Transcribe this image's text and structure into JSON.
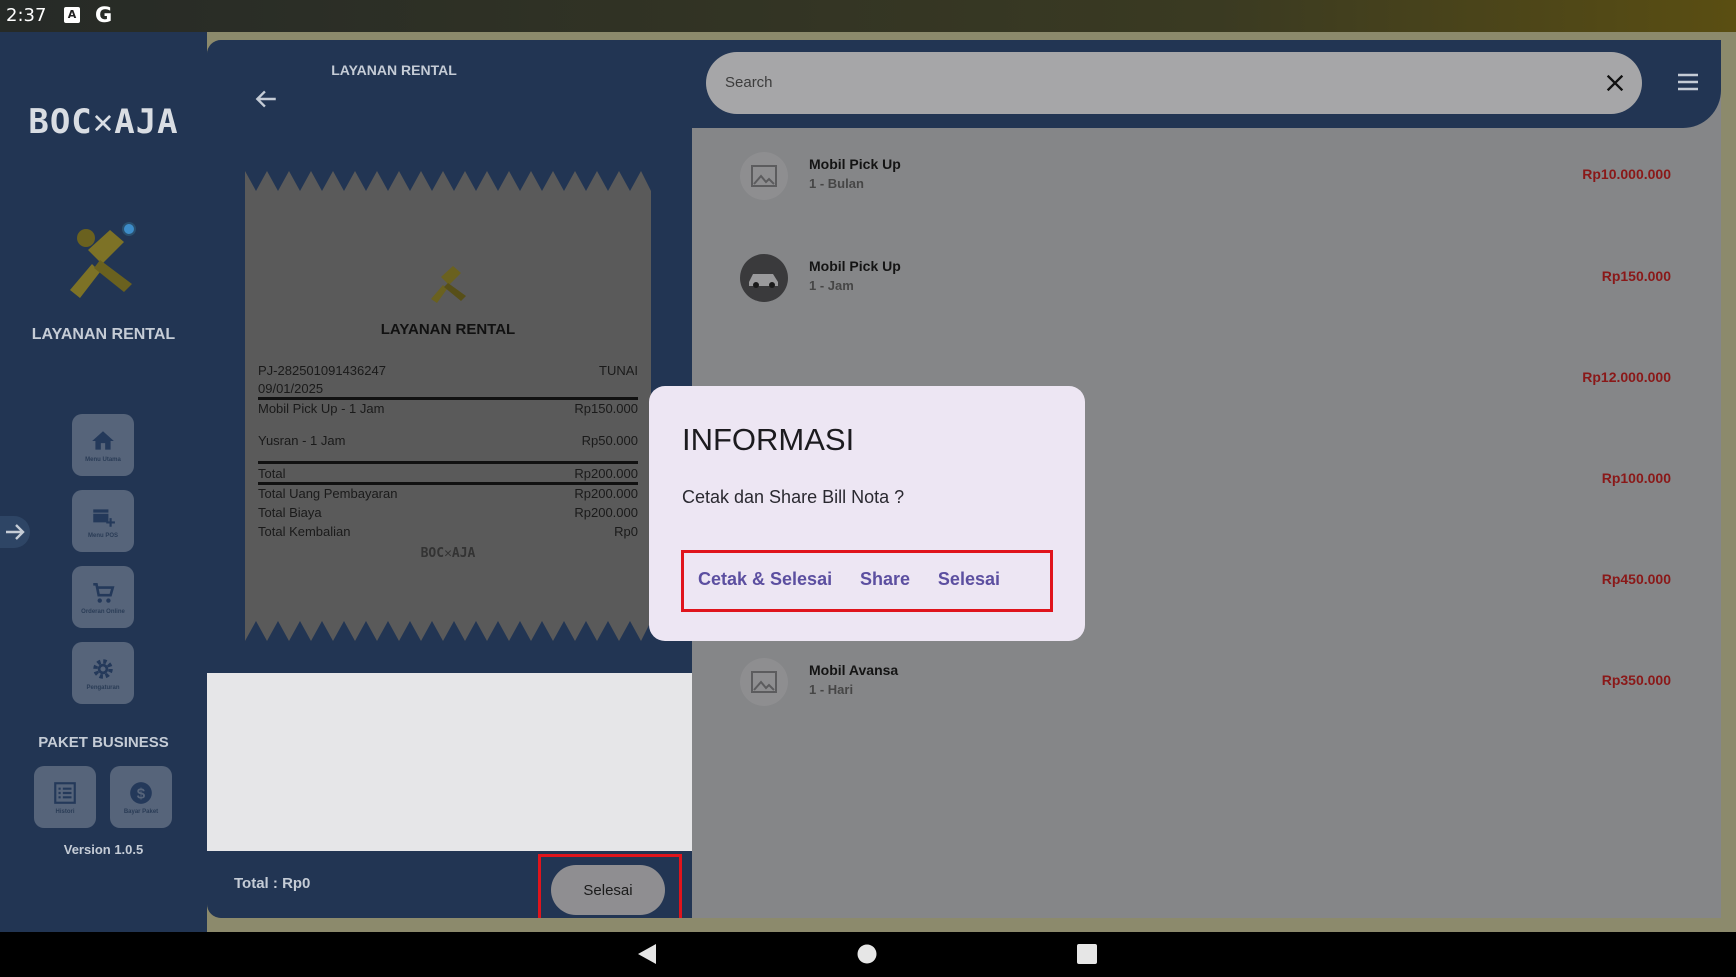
{
  "status_bar": {
    "time": "2:37",
    "icon_a": "A",
    "icon_g": "G"
  },
  "sidebar": {
    "logo_text": "BOC✕AJA",
    "brand_title": "LAYANAN RENTAL",
    "buttons": [
      {
        "icon": "home-icon",
        "caption": "Menu Utama"
      },
      {
        "icon": "pos-icon",
        "caption": "Menu POS"
      },
      {
        "icon": "cart-icon",
        "caption": "Orderan Online"
      },
      {
        "icon": "gear-icon",
        "caption": "Pengaturan"
      }
    ],
    "paket_title": "PAKET BUSINESS",
    "paket_buttons": [
      {
        "icon": "list-icon",
        "caption": "Histori"
      },
      {
        "icon": "dollar-icon",
        "caption": "Bayar Paket"
      }
    ],
    "version": "Version 1.0.5"
  },
  "middle": {
    "title": "LAYANAN RENTAL",
    "footer": {
      "total_label": "Total :",
      "total_value": "Rp0",
      "selesai_label": "Selesai"
    },
    "receipt": {
      "title": "LAYANAN RENTAL",
      "invoice_no": "PJ-282501091436247",
      "payment_type": "TUNAI",
      "date": "09/01/2025",
      "lines": [
        {
          "label": "Mobil Pick Up - 1 Jam",
          "value": "Rp150.000"
        },
        {
          "label": "Yusran - 1 Jam",
          "value": "Rp50.000"
        }
      ],
      "total": {
        "label": "Total",
        "value": "Rp200.000"
      },
      "summary": [
        {
          "label": "Total Uang Pembayaran",
          "value": "Rp200.000"
        },
        {
          "label": "Total Biaya",
          "value": "Rp200.000"
        },
        {
          "label": "Total Kembalian",
          "value": "Rp0"
        }
      ],
      "footer_logo": "BOC✕AJA"
    }
  },
  "right": {
    "search_placeholder": "Search",
    "items": [
      {
        "name": "Mobil Pick Up",
        "sub": "1 - Bulan",
        "price": "Rp10.000.000"
      },
      {
        "name": "Mobil Pick Up",
        "sub": "1 - Jam",
        "price": "Rp150.000"
      },
      {
        "name": "",
        "sub": "",
        "price": "Rp12.000.000"
      },
      {
        "name": "",
        "sub": "",
        "price": "Rp100.000"
      },
      {
        "name": "",
        "sub": "",
        "price": "Rp450.000"
      },
      {
        "name": "Mobil Avansa",
        "sub": "1 - Hari",
        "price": "Rp350.000"
      }
    ]
  },
  "dialog": {
    "title": "INFORMASI",
    "message": "Cetak dan Share Bill Nota ?",
    "actions": {
      "print_finish": "Cetak & Selesai",
      "share": "Share",
      "finish": "Selesai"
    }
  },
  "colors": {
    "highlight": "#e0141c",
    "accent": "#5c4fa0",
    "price": "#8a1818"
  }
}
